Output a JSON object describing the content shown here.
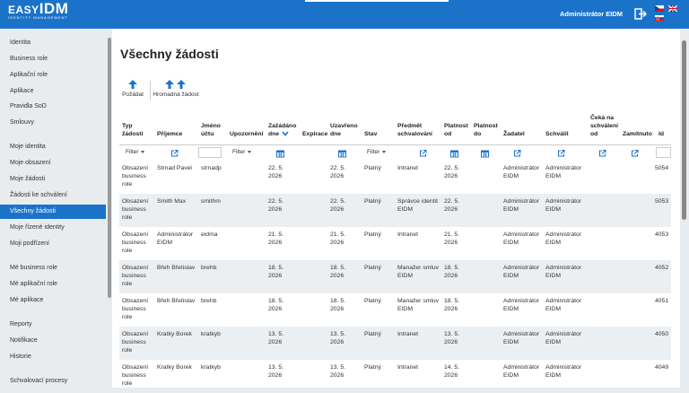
{
  "header": {
    "logo_text": "EASY",
    "logo_idm": "IDM",
    "logo_sub": "IDENTITY MANAGEMENT",
    "user": "Administrátor EIDM"
  },
  "sidebar": {
    "items": [
      {
        "label": "Identita"
      },
      {
        "label": "Business role"
      },
      {
        "label": "Aplikační role"
      },
      {
        "label": "Aplikace"
      },
      {
        "label": "Pravidla SoD"
      },
      {
        "label": "Smlouvy"
      },
      {
        "label": "Moje identita"
      },
      {
        "label": "Moje obsazení"
      },
      {
        "label": "Moje žádosti"
      },
      {
        "label": "Žádosti ke schválení"
      },
      {
        "label": "Všechny žádosti",
        "active": true
      },
      {
        "label": "Moje řízené identity"
      },
      {
        "label": "Moji podřízení"
      },
      {
        "label": "Mé business role"
      },
      {
        "label": "Mé aplikační role"
      },
      {
        "label": "Mé aplikace"
      },
      {
        "label": "Reporty"
      },
      {
        "label": "Notifikace"
      },
      {
        "label": "Historie"
      },
      {
        "label": "Schvalovací procesy"
      }
    ]
  },
  "page": {
    "title": "Všechny žádosti",
    "toolbar": {
      "request_label": "Požádat",
      "bulk_label": "Hromadná žádost"
    }
  },
  "table": {
    "headers": [
      {
        "line1": "Typ",
        "line2": "žádosti"
      },
      {
        "line1": "",
        "line2": "Příjemce"
      },
      {
        "line1": "Jméno",
        "line2": "účtu"
      },
      {
        "line1": "",
        "line2": "Upozornění"
      },
      {
        "line1": "Zažádáno",
        "line2": "dne"
      },
      {
        "line1": "",
        "line2": "Expirace"
      },
      {
        "line1": "Uzavřeno",
        "line2": "dne"
      },
      {
        "line1": "",
        "line2": "Stav"
      },
      {
        "line1": "Předmět",
        "line2": "schvalování"
      },
      {
        "line1": "Platnost",
        "line2": "od"
      },
      {
        "line1": "Platnost",
        "line2": "do"
      },
      {
        "line1": "",
        "line2": "Žadatel"
      },
      {
        "line1": "",
        "line2": "Schválil"
      },
      {
        "line1": "Čeká na",
        "line2": "schválení",
        "line3": "od"
      },
      {
        "line1": "",
        "line2": "Zamítnuto"
      },
      {
        "line1": "",
        "line2": "Id"
      }
    ],
    "filter_label": "Filter",
    "rows": [
      {
        "type": [
          "Obsazení",
          "business",
          "role"
        ],
        "recipient": [
          "Strnad Pavel"
        ],
        "account": "strnadp",
        "requested": [
          "22. 5.",
          "2026"
        ],
        "closed": [
          "22. 5.",
          "2026"
        ],
        "state": "Platný",
        "subject": [
          "Intranet"
        ],
        "valid_from": [
          "22. 5.",
          "2026"
        ],
        "requester": [
          "Administrátor",
          "EIDM"
        ],
        "approved": [
          "Administrátor",
          "EIDM"
        ],
        "id": "5054"
      },
      {
        "type": [
          "Obsazení",
          "business",
          "role"
        ],
        "recipient": [
          "Smith Max"
        ],
        "account": "smithm",
        "requested": [
          "22. 5.",
          "2026"
        ],
        "closed": [
          "22. 5.",
          "2026"
        ],
        "state": "Platný",
        "subject": [
          "Správce identit",
          "EIDM"
        ],
        "valid_from": [
          "22. 5.",
          "2026"
        ],
        "requester": [
          "Administrátor",
          "EIDM"
        ],
        "approved": [
          "Administrátor",
          "EIDM"
        ],
        "id": "5053"
      },
      {
        "type": [
          "Obsazení",
          "business",
          "role"
        ],
        "recipient": [
          "Administrátor",
          "EIDM"
        ],
        "account": "eidma",
        "requested": [
          "21. 5.",
          "2026"
        ],
        "closed": [
          "21. 5.",
          "2026"
        ],
        "state": "Platný",
        "subject": [
          "Intranet"
        ],
        "valid_from": [
          "21. 5.",
          "2026"
        ],
        "requester": [
          "Administrátor",
          "EIDM"
        ],
        "approved": [
          "Administrátor",
          "EIDM"
        ],
        "id": "4053"
      },
      {
        "type": [
          "Obsazení",
          "business",
          "role"
        ],
        "recipient": [
          "Břeh Břetislav"
        ],
        "account": "brehb",
        "requested": [
          "18. 5.",
          "2026"
        ],
        "closed": [
          "18. 5.",
          "2026"
        ],
        "state": "Platný",
        "subject": [
          "Manažer smluv",
          "EIDM"
        ],
        "valid_from": [
          "18. 5.",
          "2026"
        ],
        "requester": [
          "Administrátor",
          "EIDM"
        ],
        "approved": [
          "Administrátor",
          "EIDM"
        ],
        "id": "4052"
      },
      {
        "type": [
          "Obsazení",
          "business",
          "role"
        ],
        "recipient": [
          "Břeh Břetislav"
        ],
        "account": "brehb",
        "requested": [
          "18. 5.",
          "2026"
        ],
        "closed": [
          "18. 5.",
          "2026"
        ],
        "state": "Platný",
        "subject": [
          "Manažer smluv",
          "EIDM"
        ],
        "valid_from": [
          "18. 5.",
          "2026"
        ],
        "requester": [
          "Administrátor",
          "EIDM"
        ],
        "approved": [
          "Administrátor",
          "EIDM"
        ],
        "id": "4051"
      },
      {
        "type": [
          "Obsazení",
          "business",
          "role"
        ],
        "recipient": [
          "Kratky Borek"
        ],
        "account": "kratkyb",
        "requested": [
          "13. 5.",
          "2026"
        ],
        "closed": [
          "13. 5.",
          "2026"
        ],
        "state": "Platný",
        "subject": [
          "Intranet"
        ],
        "valid_from": [
          "13. 5.",
          "2026"
        ],
        "requester": [
          "Administrátor",
          "EIDM"
        ],
        "approved": [
          "Administrátor",
          "EIDM"
        ],
        "id": "4050"
      },
      {
        "type": [
          "Obsazení",
          "business",
          "role"
        ],
        "recipient": [
          "Kratky Borek"
        ],
        "account": "kratkyb",
        "requested": [
          "13. 5.",
          "2026"
        ],
        "closed": [
          "13. 5.",
          "2026"
        ],
        "state": "Platný",
        "subject": [
          "Intranet"
        ],
        "valid_from": [
          "14. 5.",
          "2026"
        ],
        "requester": [
          "Administrátor",
          "EIDM"
        ],
        "approved": [
          "Administrátor",
          "EIDM"
        ],
        "id": "4049"
      }
    ]
  },
  "colors": {
    "brand": "#1a73c9",
    "icon": "#1a73c9",
    "row_alt": "#eceff2"
  }
}
